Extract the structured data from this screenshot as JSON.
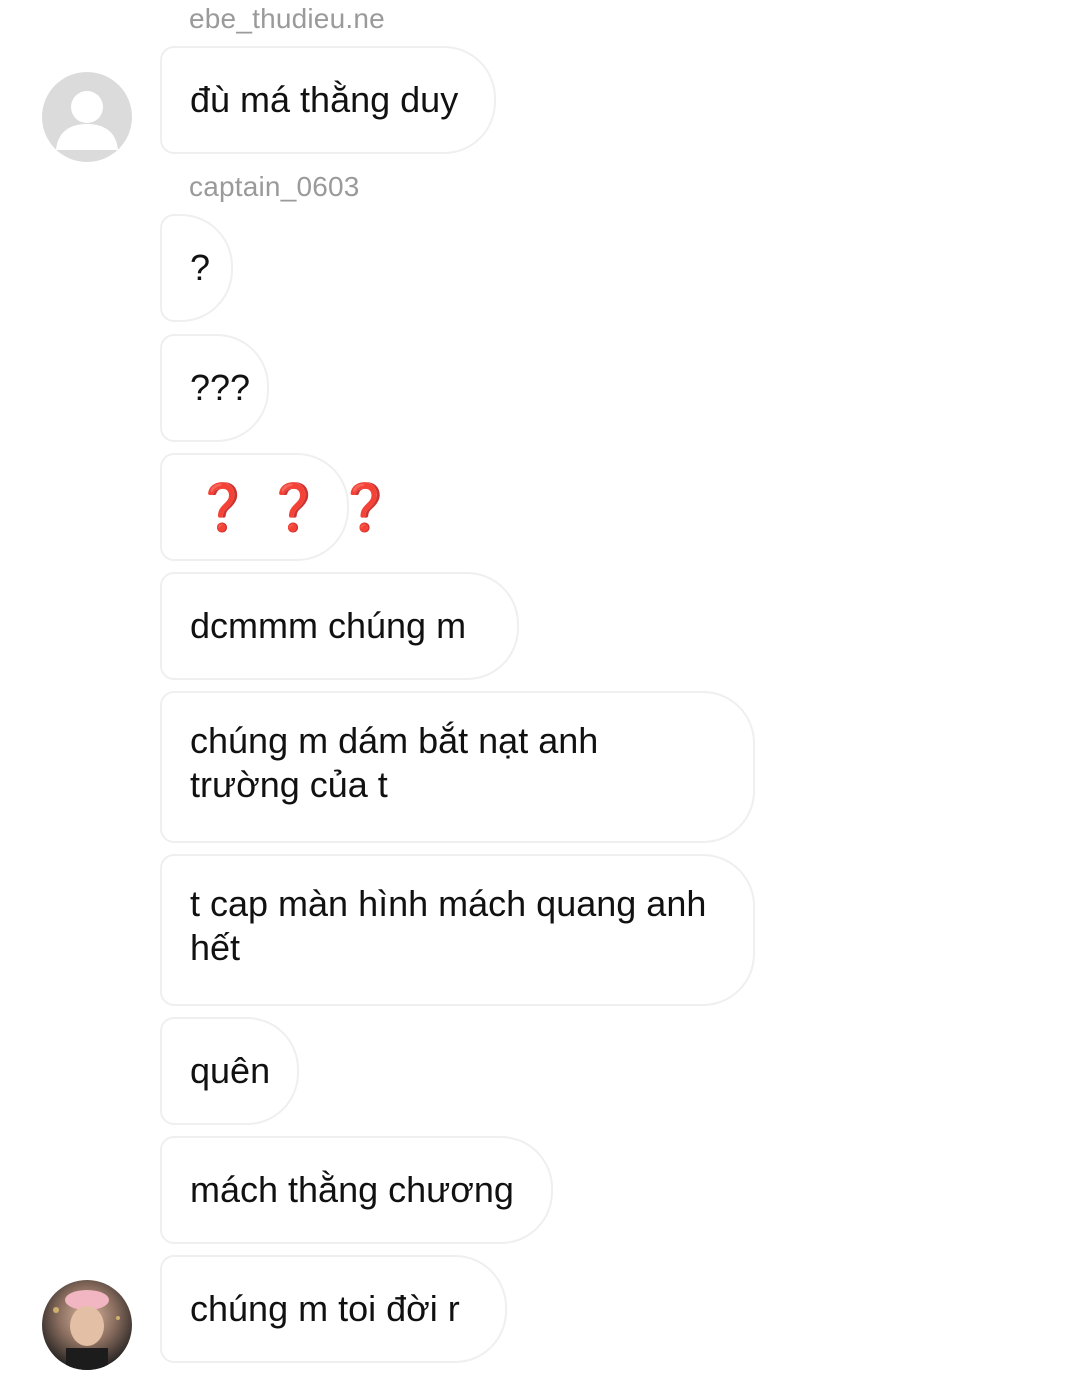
{
  "conversation": {
    "messages": [
      {
        "sender": "ebe_thudieu.ne",
        "text": "đù má thằng duy"
      },
      {
        "sender": "captain_0603",
        "text": "?"
      },
      {
        "text": "???"
      },
      {
        "text": "❓❓❓",
        "emoji": true
      },
      {
        "text": "dcmmm chúng m"
      },
      {
        "text": "chúng m dám bắt nạt anh trường của t"
      },
      {
        "text": "t cap màn hình mách quang anh hết"
      },
      {
        "text": "quên"
      },
      {
        "text": "mách thằng chương"
      },
      {
        "text": "chúng m toi đời r"
      }
    ]
  },
  "icons": {
    "avatar_placeholder": "user-silhouette-icon",
    "avatar_photo": "profile-photo"
  }
}
